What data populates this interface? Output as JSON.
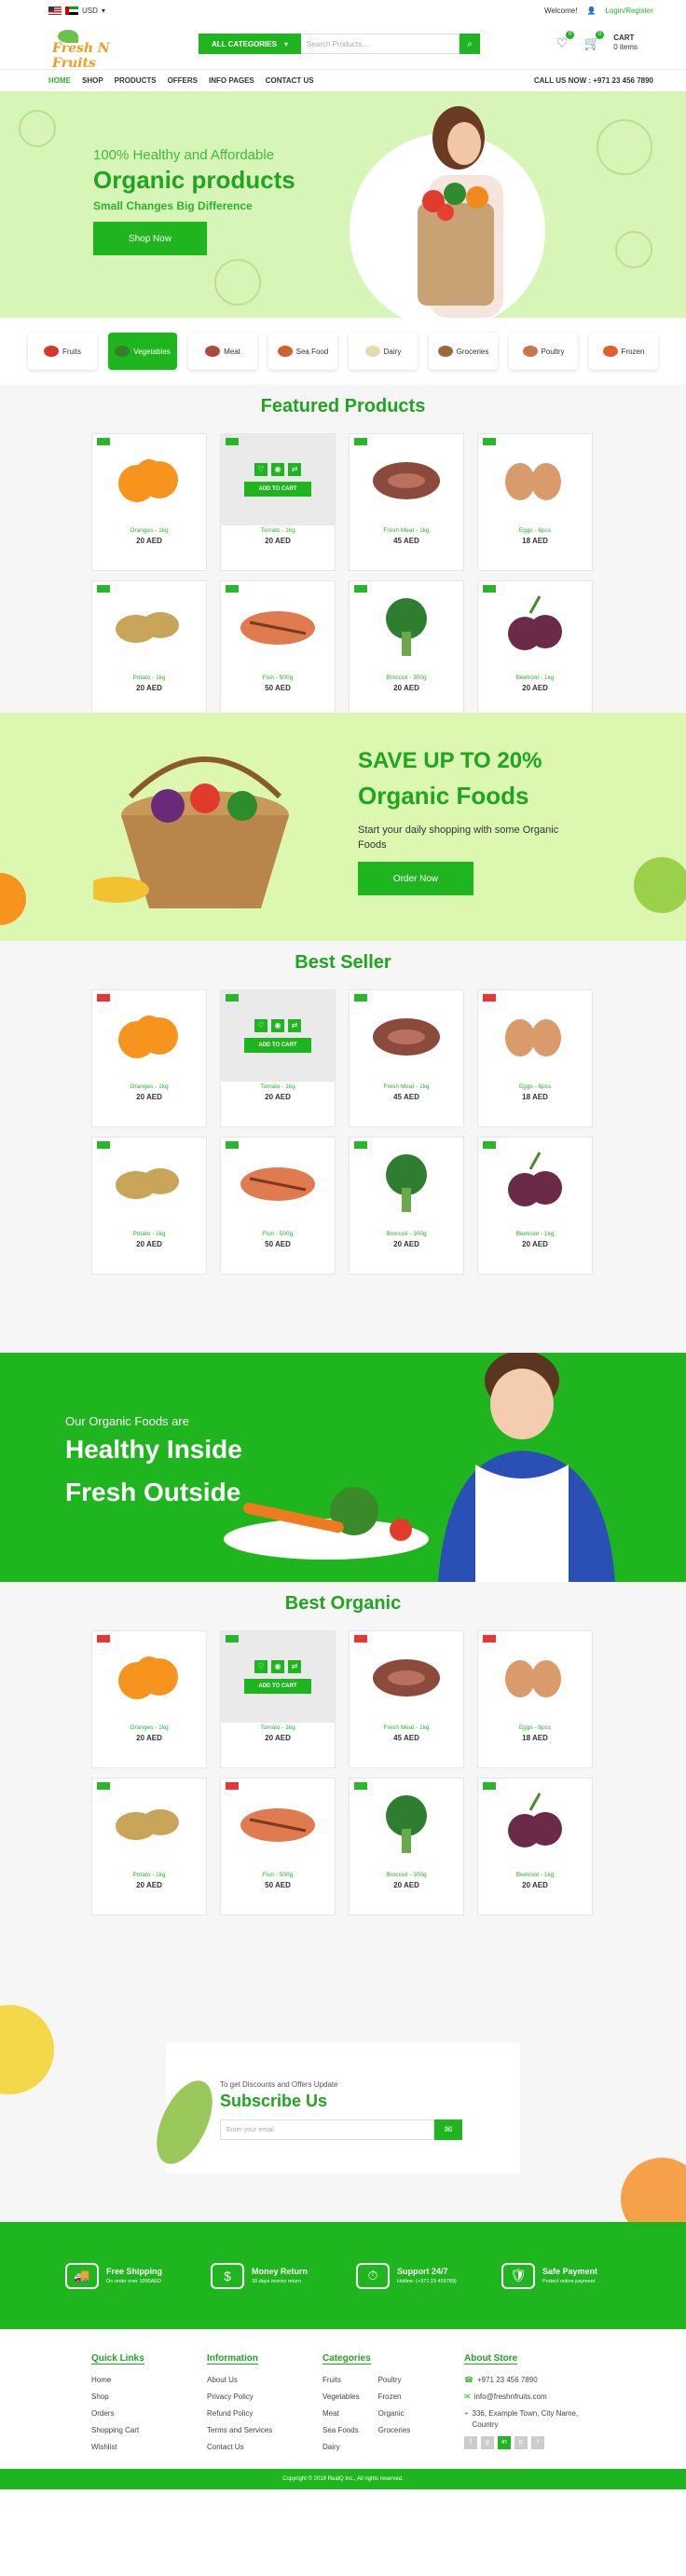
{
  "topbar": {
    "currency": "USD",
    "welcome": "Welcome!",
    "login": "Login/Register"
  },
  "header": {
    "logo": "Fresh N Fruits",
    "category_button": "ALL CATEGORIES",
    "search_placeholder": "Search Products....",
    "cart_label": "CART",
    "cart_items": "0 items",
    "wishlist_count": "0",
    "cart_count": "0"
  },
  "nav": {
    "links": [
      "HOME",
      "SHOP",
      "PRODUCTS",
      "OFFERS",
      "INFO PAGES",
      "CONTACT US"
    ],
    "call": "CALL US NOW : +971 23 456 7890"
  },
  "hero": {
    "kicker": "100% Healthy and Affordable",
    "title": "Organic products",
    "subtitle": "Small Changes Big Difference",
    "button": "Shop Now"
  },
  "categories": [
    "Fruits",
    "Vegetables",
    "Meat",
    "Sea Food",
    "Dairy",
    "Groceries",
    "Poultry",
    "Frozen"
  ],
  "sections": {
    "featured": "Featured Products",
    "best_seller": "Best Seller",
    "best_organic": "Best Organic"
  },
  "product_ui": {
    "add_to_cart": "ADD TO CART"
  },
  "products": [
    {
      "name": "Oranges - 1kg",
      "price": "20 AED",
      "color": "#f7941d"
    },
    {
      "name": "Tomato - 1kg",
      "price": "20 AED",
      "color": "#e74c3c"
    },
    {
      "name": "Fresh Meat - 1kg",
      "price": "45 AED",
      "color": "#8b4a3b"
    },
    {
      "name": "Eggs - 6pcs",
      "price": "18 AED",
      "color": "#d99a6c"
    },
    {
      "name": "Potato - 1kg",
      "price": "20 AED",
      "color": "#c9a55a"
    },
    {
      "name": "Fish - 500g",
      "price": "50 AED",
      "color": "#e07a4f"
    },
    {
      "name": "Broccoli - 300g",
      "price": "20 AED",
      "color": "#2f7d2f"
    },
    {
      "name": "Beetroot - 1kg",
      "price": "20 AED",
      "color": "#6b2a48"
    }
  ],
  "promo": {
    "line1": "SAVE UP TO 20%",
    "line2": "Organic Foods",
    "line3": "Start your daily shopping with some Organic Foods",
    "button": "Order Now"
  },
  "kid_banner": {
    "line1": "Our Organic Foods are",
    "line2": "Healthy Inside",
    "line3": "Fresh Outside"
  },
  "subscribe": {
    "kicker": "To get Discounts and Offers Update",
    "title": "Subscribe Us",
    "placeholder": "Enter your email"
  },
  "features": [
    {
      "title": "Free Shipping",
      "desc": "On order over 1000AED"
    },
    {
      "title": "Money Return",
      "desc": "30 days money return"
    },
    {
      "title": "Support 24/7",
      "desc": "Hotline: (+971 23 456789)"
    },
    {
      "title": "Safe Payment",
      "desc": "Protect online payment"
    }
  ],
  "footer": {
    "quick_links": {
      "title": "Quick Links",
      "items": [
        "Home",
        "Shop",
        "Orders",
        "Shopping Cart",
        "Wishlist"
      ]
    },
    "information": {
      "title": "Information",
      "items": [
        "About Us",
        "Privacy Policy",
        "Refund Policy",
        "Terms and Services",
        "Contact Us"
      ]
    },
    "categories": {
      "title": "Categories",
      "col1": [
        "Fruits",
        "Vegetables",
        "Meat",
        "Sea Foods",
        "Dairy"
      ],
      "col2": [
        "Poultry",
        "Frozen",
        "Organic",
        "Groceries"
      ]
    },
    "about": {
      "title": "About Store",
      "phone": "+971 23 456 7890",
      "email": "info@freshnfruits.com",
      "address": "336, Example Town, City Name, Country"
    },
    "copyright": "Copyright © 2018 RealQ Inc., All rights reserved."
  }
}
